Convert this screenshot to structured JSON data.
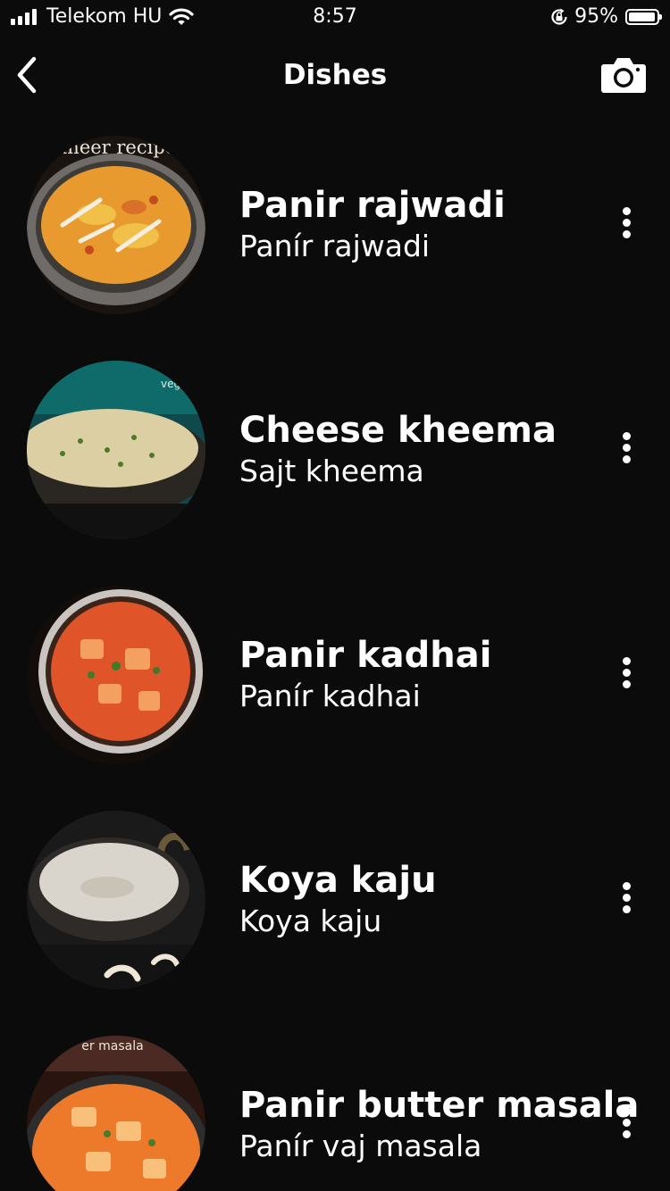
{
  "status_bar": {
    "carrier": "Telekom HU",
    "time": "8:57",
    "battery_percent": "95%",
    "battery_level": 0.95,
    "icons": [
      "signal-icon",
      "wifi-icon",
      "orientation-lock-icon",
      "battery-icon"
    ]
  },
  "nav": {
    "title": "Dishes",
    "back_icon": "chevron-left-icon",
    "camera_icon": "camera-icon"
  },
  "dishes": [
    {
      "name": "Panir rajwadi",
      "subtitle": "Panír rajwadi",
      "photo_caption": "aneer recipe"
    },
    {
      "name": "Cheese kheema",
      "subtitle": "Sajt kheema",
      "photo_caption": "veg"
    },
    {
      "name": "Panir kadhai",
      "subtitle": "Panír kadhai",
      "photo_caption": ""
    },
    {
      "name": "Koya kaju",
      "subtitle": "Koya kaju",
      "photo_caption": ""
    },
    {
      "name": "Panir butter masala",
      "subtitle": "Panír vaj masala",
      "photo_caption": "er masala"
    }
  ],
  "colors": {
    "background": "#0b0b0b",
    "text": "#ffffff"
  }
}
